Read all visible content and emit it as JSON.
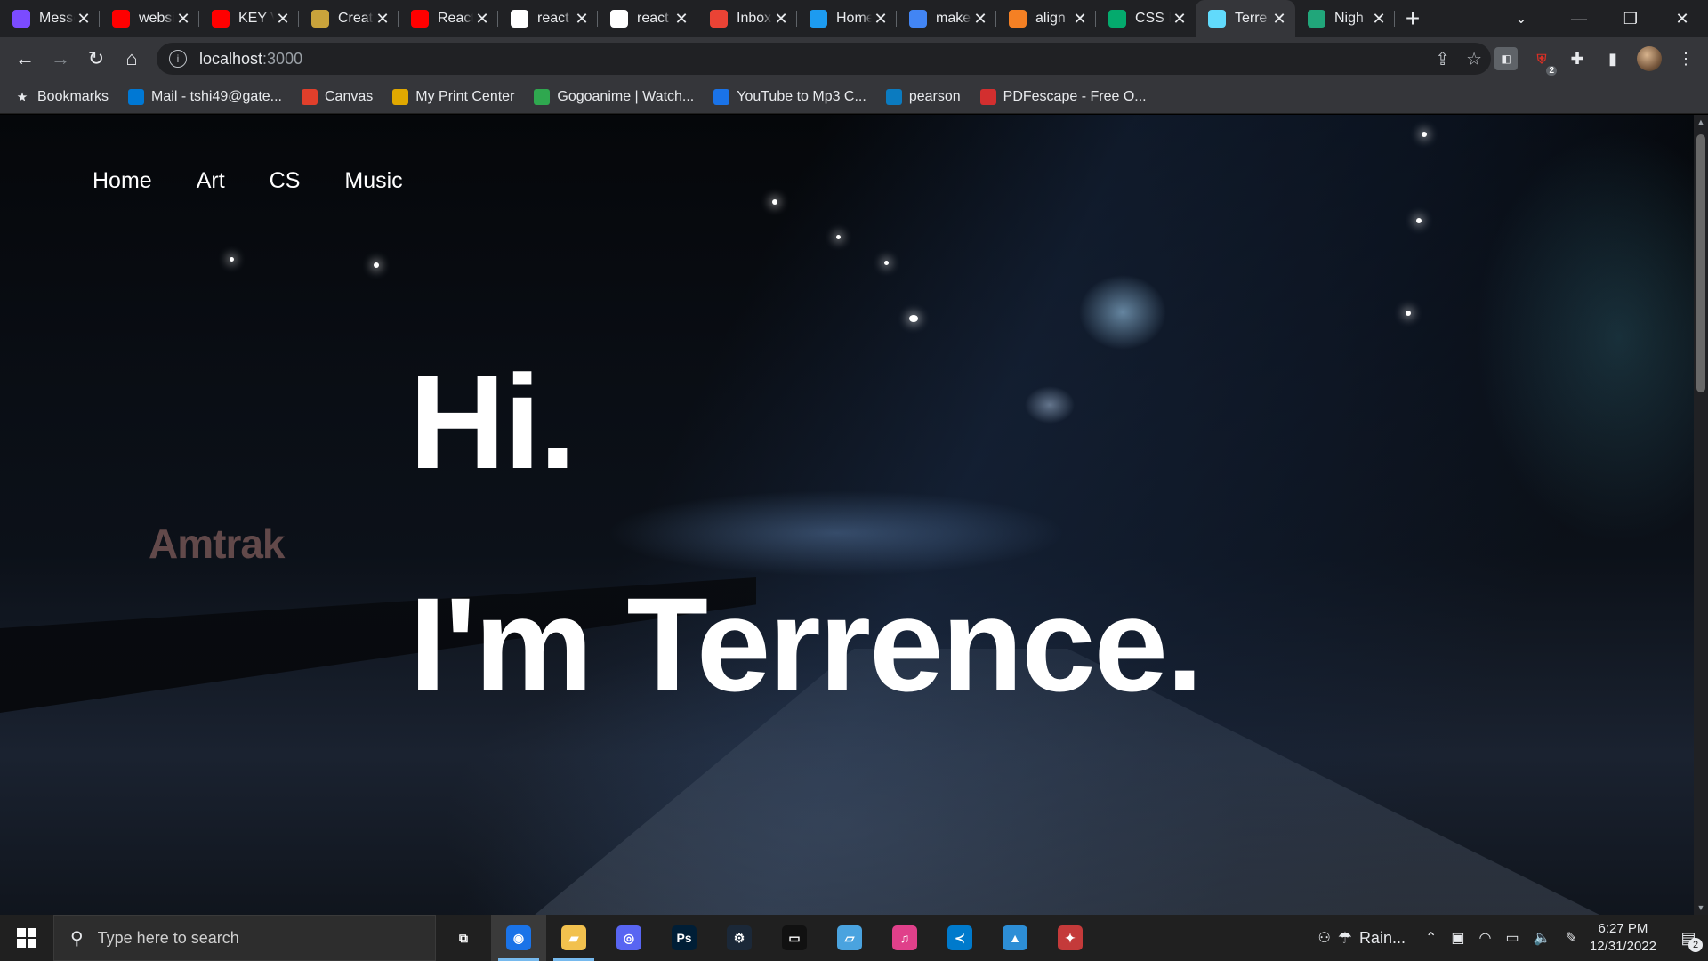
{
  "browser": {
    "tabs": [
      {
        "title": "Messenger",
        "favicon": "messenger-icon",
        "color": "#7b4bff"
      },
      {
        "title": "website",
        "favicon": "youtube-icon",
        "color": "#ff0000"
      },
      {
        "title": "KEY V",
        "favicon": "youtube-icon",
        "color": "#ff0000"
      },
      {
        "title": "Create",
        "favicon": "fd-icon",
        "color": "#c9a33b"
      },
      {
        "title": "React",
        "favicon": "youtube-icon",
        "color": "#ff0000"
      },
      {
        "title": "react",
        "favicon": "github-icon",
        "color": "#ffffff"
      },
      {
        "title": "react",
        "favicon": "github-icon",
        "color": "#ffffff"
      },
      {
        "title": "Inbox",
        "favicon": "gmail-icon",
        "color": "#ea4335"
      },
      {
        "title": "Home",
        "favicon": "twitter-icon",
        "color": "#1d9bf0"
      },
      {
        "title": "make",
        "favicon": "google-icon",
        "color": "#4285f4"
      },
      {
        "title": "align",
        "favicon": "stackoverflow-icon",
        "color": "#f48024"
      },
      {
        "title": "CSS I",
        "favicon": "w3schools-icon",
        "color": "#04aa6d"
      },
      {
        "title": "Terre",
        "favicon": "react-icon",
        "color": "#61dafb",
        "active": true
      },
      {
        "title": "Nigh",
        "favicon": "p-icon",
        "color": "#21a67a"
      }
    ],
    "close_glyph": "✕",
    "new_tab_glyph": "+",
    "url_host": "localhost",
    "url_port": ":3000",
    "bookmarks": [
      {
        "label": "Bookmarks",
        "icon": "star-icon",
        "color": "#e8eaed"
      },
      {
        "label": "Mail - tshi49@gate...",
        "icon": "outlook-icon",
        "color": "#0078d4"
      },
      {
        "label": "Canvas",
        "icon": "canvas-icon",
        "color": "#e13f2b"
      },
      {
        "label": "My Print Center",
        "icon": "print-center-icon",
        "color": "#e0a800"
      },
      {
        "label": "Gogoanime | Watch...",
        "icon": "gogoanime-icon",
        "color": "#2fa84f"
      },
      {
        "label": "YouTube to Mp3 C...",
        "icon": "play-icon",
        "color": "#1a73e8"
      },
      {
        "label": "pearson",
        "icon": "pearson-icon",
        "color": "#0b7bc0"
      },
      {
        "label": "PDFescape - Free O...",
        "icon": "pdfescape-icon",
        "color": "#d32f2f"
      }
    ]
  },
  "site": {
    "nav": [
      "Home",
      "Art",
      "CS",
      "Music"
    ],
    "hero_line1": "Hi.",
    "hero_line2": "I'm Terrence.",
    "bg_sign": "Amtrak"
  },
  "taskbar": {
    "search_placeholder": "Type here to search",
    "apps": [
      {
        "name": "task-view-icon",
        "glyph": "⧉",
        "color": "transparent"
      },
      {
        "name": "chrome-icon",
        "glyph": "◉",
        "color": "#1a73e8",
        "active": true,
        "running": true
      },
      {
        "name": "file-explorer-icon",
        "glyph": "▰",
        "color": "#f2c14e",
        "running": true
      },
      {
        "name": "discord-icon",
        "glyph": "◎",
        "color": "#5865f2"
      },
      {
        "name": "photoshop-icon",
        "glyph": "Ps",
        "color": "#001e36"
      },
      {
        "name": "steam-icon",
        "glyph": "⚙",
        "color": "#1b2838"
      },
      {
        "name": "terminal-icon",
        "glyph": "▭",
        "color": "#111111"
      },
      {
        "name": "notes-icon",
        "glyph": "▱",
        "color": "#4aa3df"
      },
      {
        "name": "itunes-icon",
        "glyph": "♫",
        "color": "#e0408a"
      },
      {
        "name": "vscode-icon",
        "glyph": "≺",
        "color": "#007acc"
      },
      {
        "name": "photos-icon",
        "glyph": "▲",
        "color": "#2d8ed6"
      },
      {
        "name": "app-icon",
        "glyph": "✦",
        "color": "#c43a3a"
      }
    ],
    "weather": "Rain...",
    "time": "6:27 PM",
    "date": "12/31/2022",
    "notification_count": "2"
  }
}
